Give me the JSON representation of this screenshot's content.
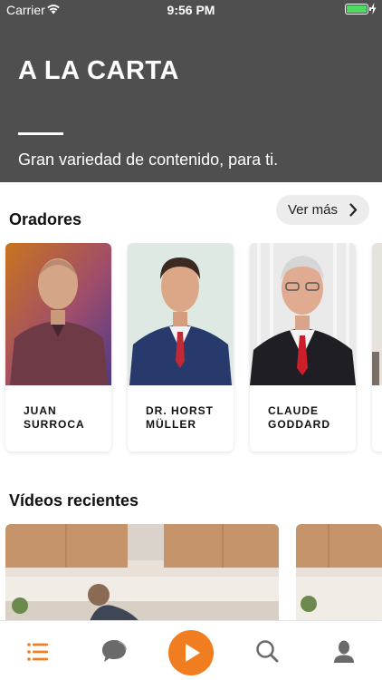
{
  "status_bar": {
    "carrier": "Carrier",
    "time": "9:56 PM",
    "battery_level": 1.0
  },
  "hero": {
    "title": "A LA CARTA",
    "subtitle": "Gran variedad de contenido, para ti."
  },
  "speakers_section": {
    "title": "Oradores",
    "more_label": "Ver más",
    "speakers": [
      {
        "name": "JUAN\nSURROCA"
      },
      {
        "name": "DR. HORST\nMÜLLER"
      },
      {
        "name": "CLAUDE\nGODDARD"
      }
    ]
  },
  "videos_section": {
    "title": "Vídeos recientes"
  },
  "tab_bar": {
    "tabs": [
      "list-icon",
      "chat-icon",
      "play-icon",
      "search-icon",
      "user-icon"
    ],
    "active_tab": "list-icon"
  },
  "colors": {
    "accent": "#f07d1f",
    "hero_bg": "#4f4f4f",
    "battery": "#4cd964"
  }
}
